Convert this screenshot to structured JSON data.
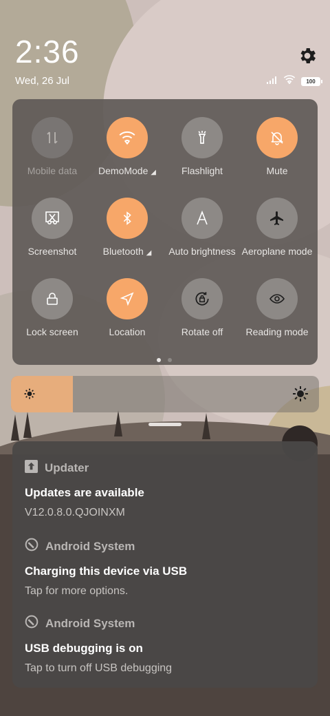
{
  "status_bar": {
    "time": "2:36",
    "date": "Wed, 26 Jul",
    "battery": "100",
    "icons": [
      "signal-icon",
      "wifi-icon",
      "battery-icon"
    ],
    "settings_icon": "gear-icon"
  },
  "quick_settings": {
    "tiles": [
      {
        "label": "Mobile data",
        "icon": "mobile-data-icon",
        "state": "disabled"
      },
      {
        "label": "DemoMode",
        "icon": "wifi-icon",
        "state": "on",
        "expandable": true
      },
      {
        "label": "Flashlight",
        "icon": "flashlight-icon",
        "state": "off"
      },
      {
        "label": "Mute",
        "icon": "bell-off-icon",
        "state": "on"
      },
      {
        "label": "Screenshot",
        "icon": "scissors-icon",
        "state": "off"
      },
      {
        "label": "Bluetooth",
        "icon": "bluetooth-icon",
        "state": "on",
        "expandable": true
      },
      {
        "label": "Auto brightness",
        "icon": "letter-a-icon",
        "state": "off"
      },
      {
        "label": "Aeroplane mode",
        "icon": "airplane-icon",
        "state": "off"
      },
      {
        "label": "Lock screen",
        "icon": "lock-icon",
        "state": "off"
      },
      {
        "label": "Location",
        "icon": "location-arrow-icon",
        "state": "on"
      },
      {
        "label": "Rotate off",
        "icon": "rotate-lock-icon",
        "state": "off"
      },
      {
        "label": "Reading mode",
        "icon": "eye-icon",
        "state": "off"
      }
    ],
    "page_count": 2,
    "current_page": 1
  },
  "brightness": {
    "level": 0.2
  },
  "notifications": [
    {
      "app": "Updater",
      "app_icon": "arrow-up-icon",
      "title": "Updates are available",
      "body": "V12.0.8.0.QJOINXM"
    },
    {
      "app": "Android System",
      "app_icon": "android-system-icon",
      "title": "Charging this device via USB",
      "body": "Tap for more options."
    },
    {
      "app": "Android System",
      "app_icon": "android-system-icon",
      "title": "USB debugging is on",
      "body": "Tap to turn off USB debugging"
    }
  ],
  "colors": {
    "accent_on": "#f7a769",
    "tile_off": "#8d8986",
    "brightness_fill": "#e7ad7c"
  }
}
